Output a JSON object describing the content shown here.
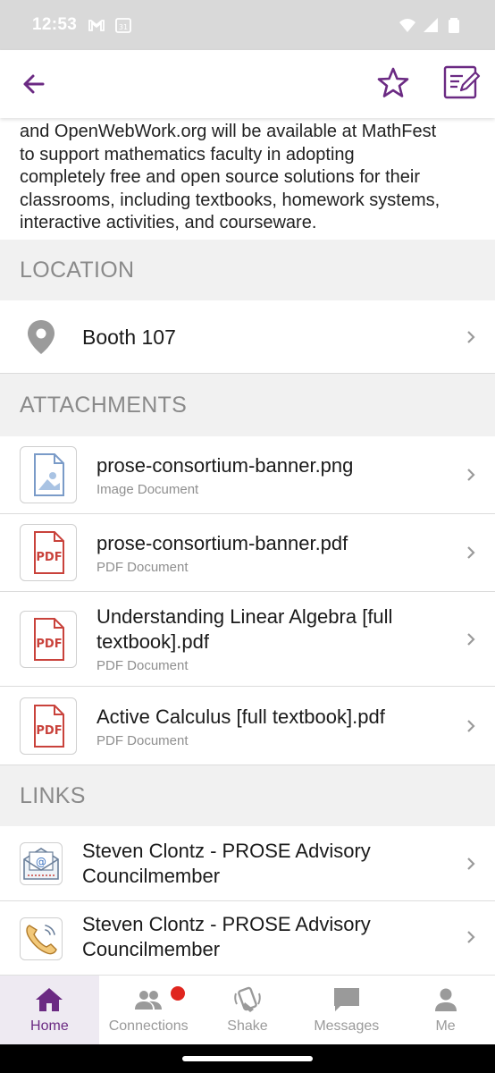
{
  "status_bar": {
    "time": "12:53",
    "icons": [
      "gmail-icon",
      "calendar-icon",
      "wifi-icon",
      "signal-icon",
      "battery-icon"
    ]
  },
  "app_bar": {
    "back_icon": "arrow-left-icon",
    "favorite_icon": "star-icon",
    "note_icon": "note-edit-icon",
    "accent_color": "#6b2a83"
  },
  "description": {
    "lines": [
      "and OpenWebWork.org will be available at MathFest",
      "to support mathematics faculty in adopting",
      "completely free and open source solutions for their",
      "classrooms, including textbooks, homework systems,",
      "interactive activities, and courseware."
    ]
  },
  "location": {
    "header": "LOCATION",
    "booth": "Booth 107"
  },
  "attachments": {
    "header": "ATTACHMENTS",
    "items": [
      {
        "title": "prose-consortium-banner.png",
        "type": "Image Document",
        "icon": "image-file-icon"
      },
      {
        "title": "prose-consortium-banner.pdf",
        "type": "PDF Document",
        "icon": "pdf-file-icon"
      },
      {
        "title_line1": "Understanding Linear Algebra [full",
        "title_line2": "textbook].pdf",
        "type": "PDF Document",
        "icon": "pdf-file-icon"
      },
      {
        "title": "Active Calculus [full textbook].pdf",
        "type": "PDF Document",
        "icon": "pdf-file-icon"
      }
    ],
    "pdf_label": "PDF"
  },
  "links": {
    "header": "LINKS",
    "items": [
      {
        "line1": "Steven Clontz - PROSE Advisory",
        "line2": "Councilmember",
        "icon": "email-icon"
      },
      {
        "line1": "Steven Clontz - PROSE Advisory",
        "line2": "Councilmember",
        "icon": "phone-icon"
      }
    ]
  },
  "bottom_nav": {
    "items": [
      {
        "label": "Home",
        "icon": "home-icon",
        "active": true
      },
      {
        "label": "Connections",
        "icon": "people-icon",
        "active": false,
        "badge": true
      },
      {
        "label": "Shake",
        "icon": "shake-icon",
        "active": false
      },
      {
        "label": "Messages",
        "icon": "message-icon",
        "active": false
      },
      {
        "label": "Me",
        "icon": "person-icon",
        "active": false
      }
    ]
  }
}
